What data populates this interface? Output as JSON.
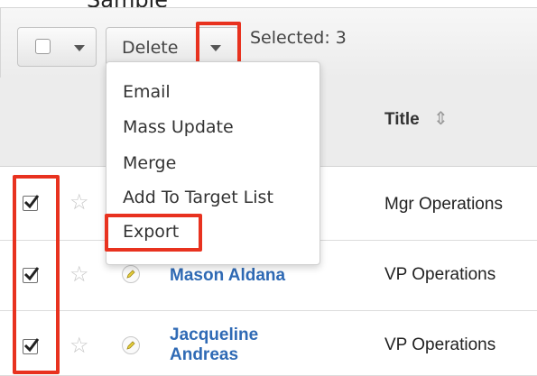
{
  "caption": "Sample",
  "toolbar": {
    "delete_label": "Delete",
    "selected_text": "Selected: 3"
  },
  "header": {
    "title_col": "Title",
    "sort_icon": "sort-icon"
  },
  "menu": {
    "items": [
      "Email",
      "Mass Update",
      "Merge",
      "Add To Target List",
      "Export"
    ]
  },
  "rows": [
    {
      "checked": true,
      "name": "",
      "title": "Mgr Operations"
    },
    {
      "checked": true,
      "name": "Mason Aldana",
      "title": "VP Operations"
    },
    {
      "checked": true,
      "name_line1": "Jacqueline",
      "name_line2": "Andreas",
      "title": "VP Operations"
    }
  ],
  "colors": {
    "highlight": "#e8321f",
    "link": "#2f6ab5"
  }
}
